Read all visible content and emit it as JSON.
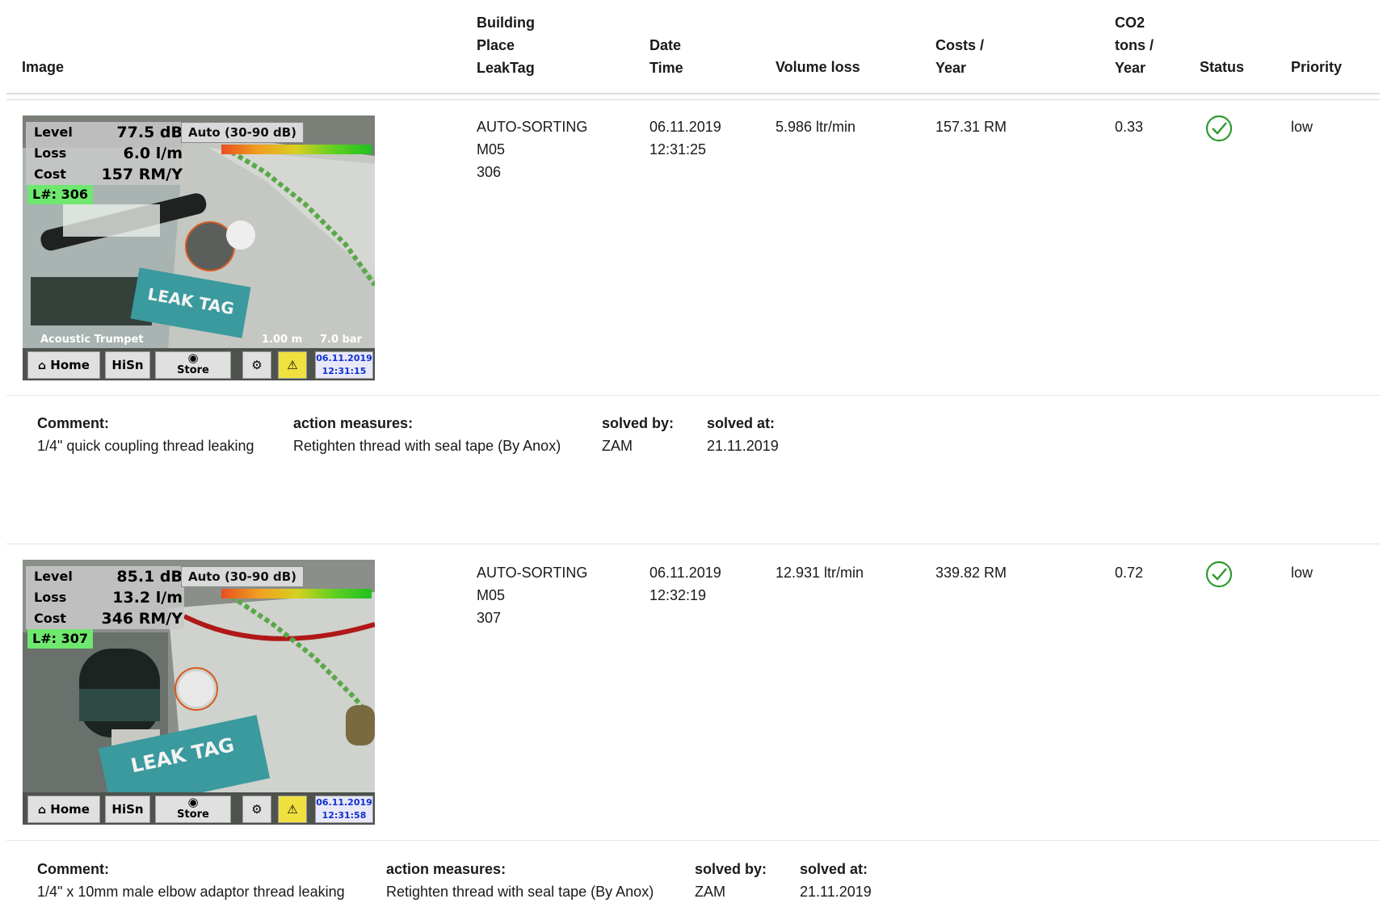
{
  "header": {
    "image": "Image",
    "building": [
      "Building",
      "Place",
      "LeakTag"
    ],
    "date": [
      "Date",
      "Time"
    ],
    "volume": "Volume loss",
    "costs": [
      "Costs /",
      "Year"
    ],
    "co2": [
      "CO2",
      "tons /",
      "Year"
    ],
    "status": "Status",
    "priority": "Priority"
  },
  "rows": [
    {
      "building": "AUTO-SORTING",
      "place": "M05",
      "leaktag": "306",
      "date": "06.11.2019",
      "time": "12:31:25",
      "volume": "5.986 ltr/min",
      "costs": "157.31 RM",
      "co2": "0.33",
      "status_icon": "check-circle-icon",
      "priority": "low",
      "screen": {
        "level_label": "Level",
        "level": "77.5 dB",
        "loss_label": "Loss",
        "loss": "6.0 l/m",
        "cost_label": "Cost",
        "cost": "157 RM/Y",
        "lnum": "L#: 306",
        "auto": "Auto (30-90 dB)",
        "sensor": "Acoustic Trumpet",
        "distance": "1.00 m",
        "pressure": "7.0 bar",
        "home": "Home",
        "hisn": "HiSn",
        "store": "Store",
        "date": "06.11.2019",
        "time": "12:31:15",
        "tag": "LEAK TAG"
      },
      "details": {
        "comment_label": "Comment:",
        "comment": "1/4\" quick coupling thread leaking",
        "action_label": "action measures:",
        "action": "Retighten thread with seal tape (By Anox)",
        "solved_by_label": "solved by:",
        "solved_by": "ZAM",
        "solved_at_label": "solved at:",
        "solved_at": "21.11.2019"
      }
    },
    {
      "building": "AUTO-SORTING",
      "place": "M05",
      "leaktag": "307",
      "date": "06.11.2019",
      "time": "12:32:19",
      "volume": "12.931 ltr/min",
      "costs": "339.82 RM",
      "co2": "0.72",
      "status_icon": "check-circle-icon",
      "priority": "low",
      "screen": {
        "level_label": "Level",
        "level": "85.1 dB",
        "loss_label": "Loss",
        "loss": "13.2 l/m",
        "cost_label": "Cost",
        "cost": "346 RM/Y",
        "lnum": "L#: 307",
        "auto": "Auto (30-90 dB)",
        "home": "Home",
        "hisn": "HiSn",
        "store": "Store",
        "date": "06.11.2019",
        "time": "12:31:58",
        "tag": "LEAK TAG"
      },
      "details": {
        "comment_label": "Comment:",
        "comment": "1/4\" x 10mm male elbow adaptor thread leaking",
        "action_label": "action measures:",
        "action": "Retighten thread with seal tape (By Anox)",
        "solved_by_label": "solved by:",
        "solved_by": "ZAM",
        "solved_at_label": "solved at:",
        "solved_at": "21.11.2019"
      }
    }
  ],
  "colors": {
    "check": "#2e9a2e",
    "rule": "#d8d8d8",
    "tag": "#3a9a9e",
    "lnum": "#6ee86e"
  }
}
